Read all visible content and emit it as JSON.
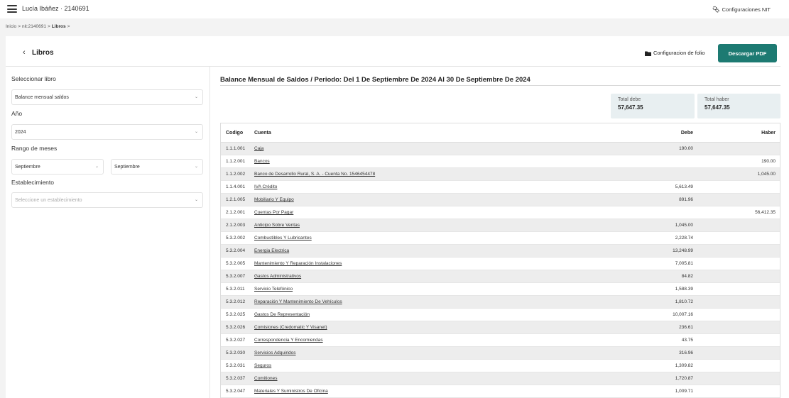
{
  "topbar": {
    "user": "Lucía Ibáñez · 2140691",
    "config_label": "Configuraciones NIT"
  },
  "breadcrumb": {
    "home": "Inicio",
    "sep": ">",
    "nit": "nit:2140691",
    "current": "Libros"
  },
  "header": {
    "title": "Libros",
    "folio_label": "Configuracion de folio",
    "pdf_label": "Descargar PDF"
  },
  "sidebar": {
    "libro_label": "Seleccionar libro",
    "libro_value": "Balance mensual saldos",
    "anio_label": "Año",
    "anio_value": "2024",
    "rango_label": "Rango de meses",
    "mes_desde": "Septiembre",
    "mes_hasta": "Septiembre",
    "estab_label": "Establecimiento",
    "estab_placeholder": "Seleccione un establecimiento"
  },
  "report": {
    "title": "Balance Mensual de Saldos / Periodo: Del 1 De Septiembre De 2024 Al 30 De Septiembre De 2024",
    "total_debe_label": "Total debe",
    "total_debe": "57,647.35",
    "total_haber_label": "Total haber",
    "total_haber": "57,647.35"
  },
  "table": {
    "headers": {
      "codigo": "Codigo",
      "cuenta": "Cuenta",
      "debe": "Debe",
      "haber": "Haber"
    },
    "rows": [
      {
        "codigo": "1.1.1.001",
        "cuenta": "Caja",
        "debe": "190.00",
        "haber": ""
      },
      {
        "codigo": "1.1.2.001",
        "cuenta": "Bancos",
        "debe": "",
        "haber": "190.00"
      },
      {
        "codigo": "1.1.2.002",
        "cuenta": "Banco de Desarrollo Rural, S. A. - Cuenta No. 1546454478",
        "debe": "",
        "haber": "1,045.00"
      },
      {
        "codigo": "1.1.4.001",
        "cuenta": "IVA Crédito",
        "debe": "5,613.49",
        "haber": ""
      },
      {
        "codigo": "1.2.1.005",
        "cuenta": "Mobiliario Y Equipo",
        "debe": "891.96",
        "haber": ""
      },
      {
        "codigo": "2.1.2.001",
        "cuenta": "Cuentas Por Pagar",
        "debe": "",
        "haber": "56,412.35"
      },
      {
        "codigo": "2.1.2.003",
        "cuenta": "Anticipo Sobre Ventas",
        "debe": "1,045.00",
        "haber": ""
      },
      {
        "codigo": "5.3.2.002",
        "cuenta": "Combustibles Y Lubricantes",
        "debe": "2,228.74",
        "haber": ""
      },
      {
        "codigo": "5.3.2.004",
        "cuenta": "Energia Electrica",
        "debe": "13,248.99",
        "haber": ""
      },
      {
        "codigo": "5.3.2.005",
        "cuenta": "Mantenimiento Y Reparación Instalaciones",
        "debe": "7,005.81",
        "haber": ""
      },
      {
        "codigo": "5.3.2.007",
        "cuenta": "Gastos Administrativos",
        "debe": "84.82",
        "haber": ""
      },
      {
        "codigo": "5.3.2.011",
        "cuenta": "Servicio Telefónico",
        "debe": "1,588.39",
        "haber": ""
      },
      {
        "codigo": "5.3.2.012",
        "cuenta": "Reparación Y Mantenimiento De Vehículos",
        "debe": "1,810.72",
        "haber": ""
      },
      {
        "codigo": "5.3.2.025",
        "cuenta": "Gastos De Representación",
        "debe": "10,007.16",
        "haber": ""
      },
      {
        "codigo": "5.3.2.026",
        "cuenta": "Comisiones (Credomatic Y Visanet)",
        "debe": "236.61",
        "haber": ""
      },
      {
        "codigo": "5.3.2.027",
        "cuenta": "Correspondencia Y Encomiendas",
        "debe": "43.75",
        "haber": ""
      },
      {
        "codigo": "5.3.2.030",
        "cuenta": "Servicios Adquiridos",
        "debe": "316.96",
        "haber": ""
      },
      {
        "codigo": "5.3.2.031",
        "cuenta": "Seguros",
        "debe": "1,309.82",
        "haber": ""
      },
      {
        "codigo": "5.3.2.037",
        "cuenta": "Comitiones",
        "debe": "1,720.87",
        "haber": ""
      },
      {
        "codigo": "5.3.2.047",
        "cuenta": "Materiales Y Suministros De Oficina",
        "debe": "1,009.71",
        "haber": ""
      }
    ]
  }
}
